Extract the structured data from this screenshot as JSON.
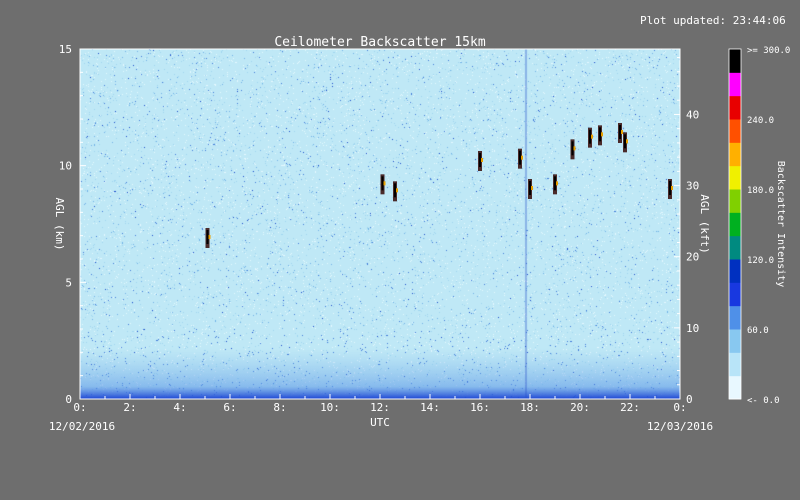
{
  "plot_updated": "Plot updated: 23:44:06",
  "chart_data": {
    "type": "heatmap",
    "title": "Ceilometer Backscatter 15km",
    "xlabel": "UTC",
    "ylabel_left": "AGL (km)",
    "ylabel_right": "AGL (kft)",
    "x_ticks": [
      "0:",
      "2:",
      "4:",
      "6:",
      "8:",
      "10:",
      "12:",
      "14:",
      "16:",
      "18:",
      "20:",
      "22:",
      "0:"
    ],
    "x_range_hours": [
      0,
      24
    ],
    "y_range_km": [
      0,
      15
    ],
    "y_ticks_km": [
      "0",
      "5",
      "10",
      "15"
    ],
    "y_range_kft": [
      0,
      49.2
    ],
    "y_ticks_kft": [
      "0",
      "10",
      "20",
      "30",
      "40"
    ],
    "date_start": "12/02/2016",
    "date_end": "12/03/2016",
    "colorbar": {
      "label": "Backscatter Intensity",
      "range": [
        0,
        300
      ],
      "ticks": [
        "<-  0.0",
        "60.0",
        "120.0",
        "180.0",
        "240.0",
        ">= 300.0"
      ],
      "colors": [
        "#e8f8ff",
        "#b8e4f8",
        "#88c8f0",
        "#4f90e8",
        "#1838e0",
        "#0030c0",
        "#008a80",
        "#00b020",
        "#80d000",
        "#f0f000",
        "#ffb000",
        "#ff5000",
        "#e80000",
        "#ff00ff",
        "#000000"
      ]
    },
    "cloud_features": [
      {
        "time_h": 5.1,
        "alt_km": 6.9
      },
      {
        "time_h": 12.1,
        "alt_km": 9.2
      },
      {
        "time_h": 12.6,
        "alt_km": 8.9
      },
      {
        "time_h": 16.0,
        "alt_km": 10.2
      },
      {
        "time_h": 17.6,
        "alt_km": 10.3
      },
      {
        "time_h": 18.0,
        "alt_km": 9.0
      },
      {
        "time_h": 19.0,
        "alt_km": 9.2
      },
      {
        "time_h": 19.7,
        "alt_km": 10.7
      },
      {
        "time_h": 20.4,
        "alt_km": 11.2
      },
      {
        "time_h": 20.8,
        "alt_km": 11.3
      },
      {
        "time_h": 21.6,
        "alt_km": 11.4
      },
      {
        "time_h": 21.8,
        "alt_km": 11.0
      },
      {
        "time_h": 23.6,
        "alt_km": 9.0
      }
    ]
  }
}
